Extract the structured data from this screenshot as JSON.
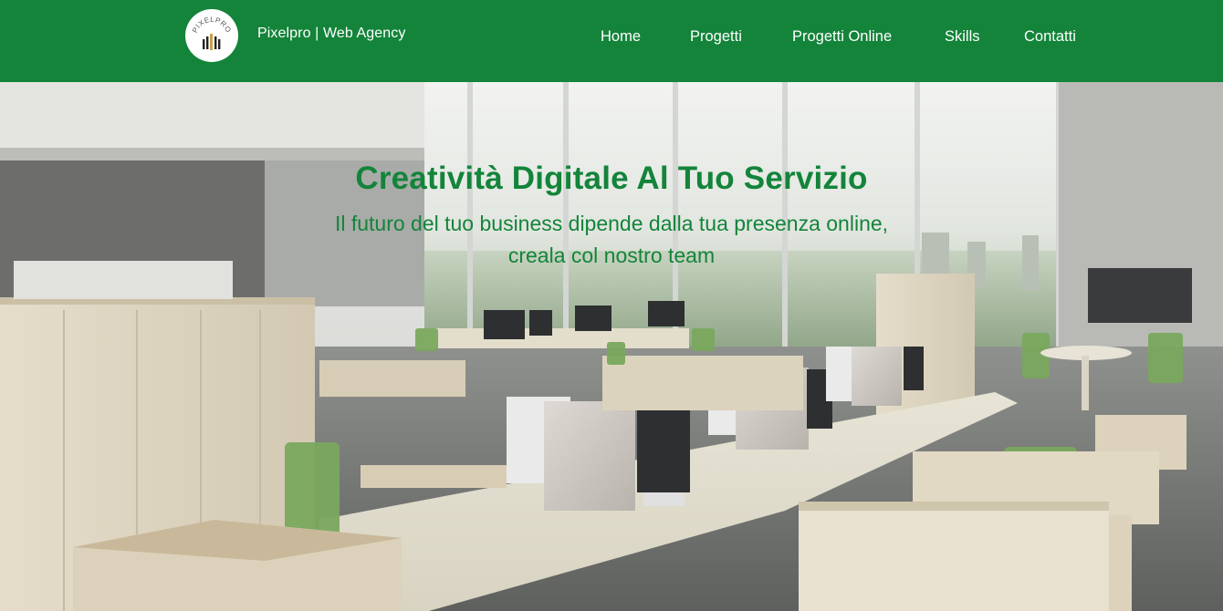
{
  "header": {
    "logo_text": "PIXELPRO",
    "brand": "Pixelpro | Web Agency",
    "nav": [
      {
        "label": "Home"
      },
      {
        "label": "Progetti"
      },
      {
        "label": "Progetti Online"
      },
      {
        "label": "Skills"
      },
      {
        "label": "Contatti"
      }
    ]
  },
  "hero": {
    "title": "Creatività Digitale Al Tuo Servizio",
    "subtitle": "Il futuro del tuo business dipende dalla tua presenza online, creala col nostro team",
    "background": "office-photo"
  },
  "colors": {
    "brand_green": "#13843a",
    "nav_text": "#ffffff"
  }
}
